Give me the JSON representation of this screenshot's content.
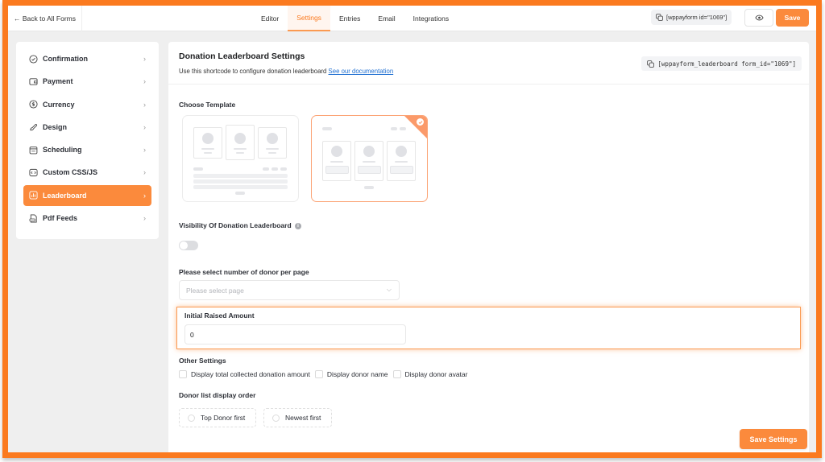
{
  "topbar": {
    "back_label": "← Back to All Forms",
    "tabs": [
      {
        "label": "Editor",
        "active": false
      },
      {
        "label": "Settings",
        "active": true
      },
      {
        "label": "Entries",
        "active": false
      },
      {
        "label": "Email",
        "active": false
      },
      {
        "label": "Integrations",
        "active": false
      }
    ],
    "shortcode": "[wppayform id=\"1069\"]",
    "preview_icon": "eye-icon",
    "save_label": "Save"
  },
  "sidebar": {
    "items": [
      {
        "label": "Confirmation",
        "icon": "check-circle-icon",
        "active": false
      },
      {
        "label": "Payment",
        "icon": "wallet-icon",
        "active": false
      },
      {
        "label": "Currency",
        "icon": "dollar-circle-icon",
        "active": false
      },
      {
        "label": "Design",
        "icon": "brush-icon",
        "active": false
      },
      {
        "label": "Scheduling",
        "icon": "calendar-icon",
        "active": false
      },
      {
        "label": "Custom CSS/JS",
        "icon": "code-icon",
        "active": false
      },
      {
        "label": "Leaderboard",
        "icon": "chart-icon",
        "active": true
      },
      {
        "label": "Pdf Feeds",
        "icon": "pdf-icon",
        "active": false
      }
    ]
  },
  "main": {
    "title": "Donation Leaderboard Settings",
    "subtitle": "Use this shortcode to configure donation leaderboard",
    "doc_link": "See our documentation",
    "shortcode": "[wppayform_leaderboard form_id=\"1069\"]",
    "choose_template_label": "Choose Template",
    "templates": [
      {
        "name": "template-1",
        "selected": false
      },
      {
        "name": "template-2",
        "selected": true
      }
    ],
    "visibility_label": "Visibility Of Donation Leaderboard",
    "visibility_enabled": false,
    "per_page_label": "Please select number of donor per page",
    "per_page_placeholder": "Please select page",
    "initial_amount_label": "Initial Raised Amount",
    "initial_amount_value": "0",
    "other_settings_label": "Other Settings",
    "other_settings": [
      {
        "label": "Display total collected donation amount",
        "checked": false
      },
      {
        "label": "Display donor name",
        "checked": false
      },
      {
        "label": "Display donor avatar",
        "checked": false
      }
    ],
    "order_label": "Donor list display order",
    "order_options": [
      {
        "label": "Top Donor first",
        "selected": false
      },
      {
        "label": "Newest first",
        "selected": false
      }
    ],
    "save_settings_label": "Save Settings"
  },
  "colors": {
    "accent": "#fb8a3c",
    "frame": "#fb7a1f",
    "link": "#1f6fd1"
  }
}
